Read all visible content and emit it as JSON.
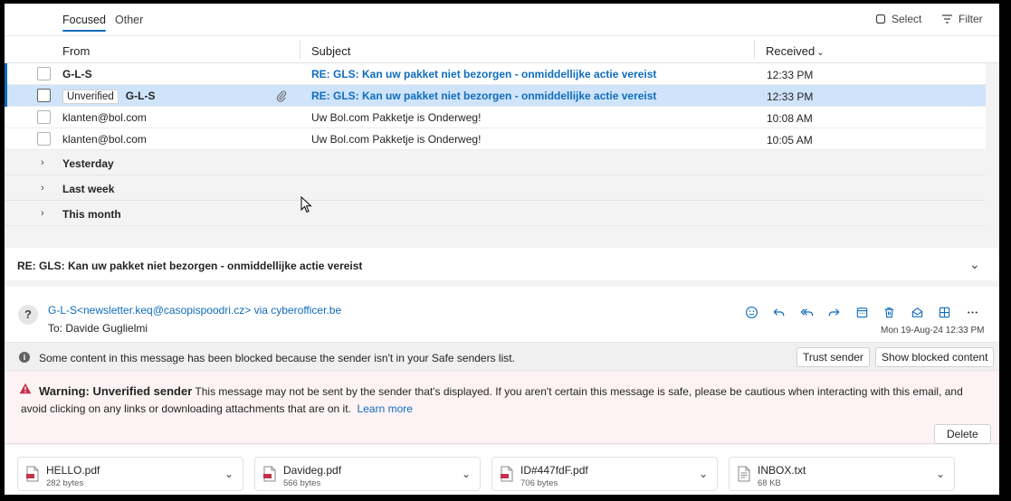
{
  "tabs": {
    "focused": "Focused",
    "other": "Other"
  },
  "toolbar": {
    "select": "Select",
    "filter": "Filter"
  },
  "columns": {
    "from": "From",
    "subject": "Subject",
    "received": "Received"
  },
  "messages": [
    {
      "from": "G-L-S",
      "subject": "RE: GLS: Kan uw pakket niet bezorgen - onmiddellijke actie vereist",
      "time": "12:33 PM"
    },
    {
      "badge": "Unverified",
      "from": "G-L-S",
      "subject": "RE: GLS: Kan uw pakket niet bezorgen - onmiddellijke actie vereist",
      "time": "12:33 PM"
    },
    {
      "from": "klanten@bol.com",
      "subject": "Uw Bol.com Pakketje is Onderweg!",
      "time": "10:08 AM"
    },
    {
      "from": "klanten@bol.com",
      "subject": "Uw Bol.com Pakketje is Onderweg!",
      "time": "10:05 AM"
    }
  ],
  "groups": [
    "Yesterday",
    "Last week",
    "This month"
  ],
  "reading": {
    "subject": "RE: GLS: Kan uw pakket niet bezorgen - onmiddellijke actie vereist",
    "avatar": "?",
    "sender": "G-L-S<newsletter.keq@casopispoodri.cz> via cyberofficer.be",
    "to": "To: Davide Guglielmi",
    "date": "Mon 19-Aug-24 12:33 PM"
  },
  "infobar": {
    "text": "Some content in this message has been blocked because the sender isn't in your Safe senders list.",
    "trust": "Trust sender",
    "show": "Show blocked content"
  },
  "warning": {
    "title": "Warning: Unverified sender",
    "body": " This message may not be sent by the sender that's displayed. If you aren't certain this message is safe, please be cautious when interacting with this email, and avoid clicking on any links or downloading attachments that are on it.",
    "link": "Learn more",
    "delete": "Delete"
  },
  "attachments": [
    {
      "name": "HELLO.pdf",
      "size": "282 bytes"
    },
    {
      "name": "Davideg.pdf",
      "size": "566 bytes"
    },
    {
      "name": "ID#447fdF.pdf",
      "size": "706 bytes"
    },
    {
      "name": "INBOX.txt",
      "size": "68 KB"
    }
  ],
  "colors": {
    "accent": "#0f6cbd",
    "selected_row": "#cfe4fa",
    "warning": "#c4314b"
  }
}
